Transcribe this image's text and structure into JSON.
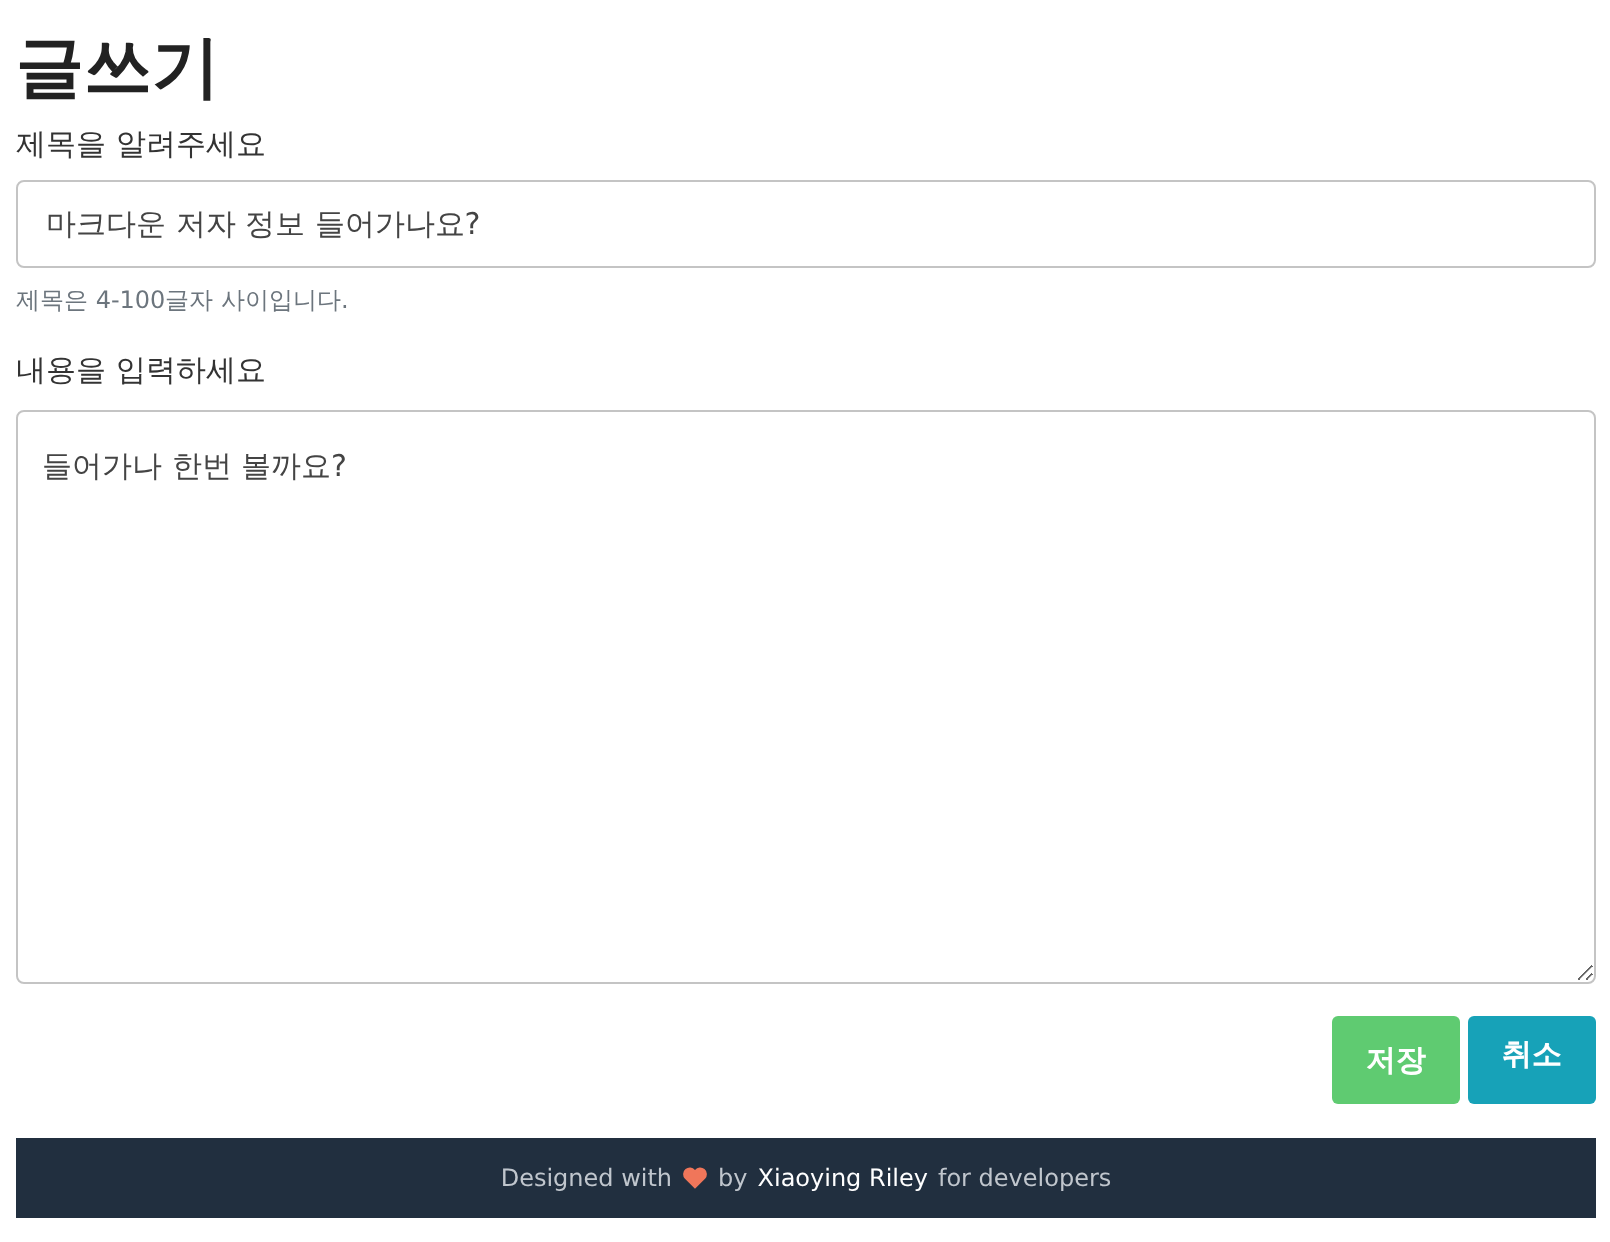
{
  "heading": "글쓰기",
  "title_field": {
    "label": "제목을 알려주세요",
    "value": "마크다운 저자 정보 들어가나요?",
    "help": "제목은 4-100글자 사이입니다."
  },
  "content_field": {
    "label": "내용을 입력하세요",
    "value": "들어가나 한번 볼까요?"
  },
  "buttons": [
    {
      "label": "저장",
      "kind": "save"
    },
    {
      "label": "취소",
      "kind": "cancel"
    }
  ],
  "footer": {
    "prefix": "Designed with",
    "by": "by",
    "author": "Xiaoying Riley",
    "suffix": "for developers"
  }
}
